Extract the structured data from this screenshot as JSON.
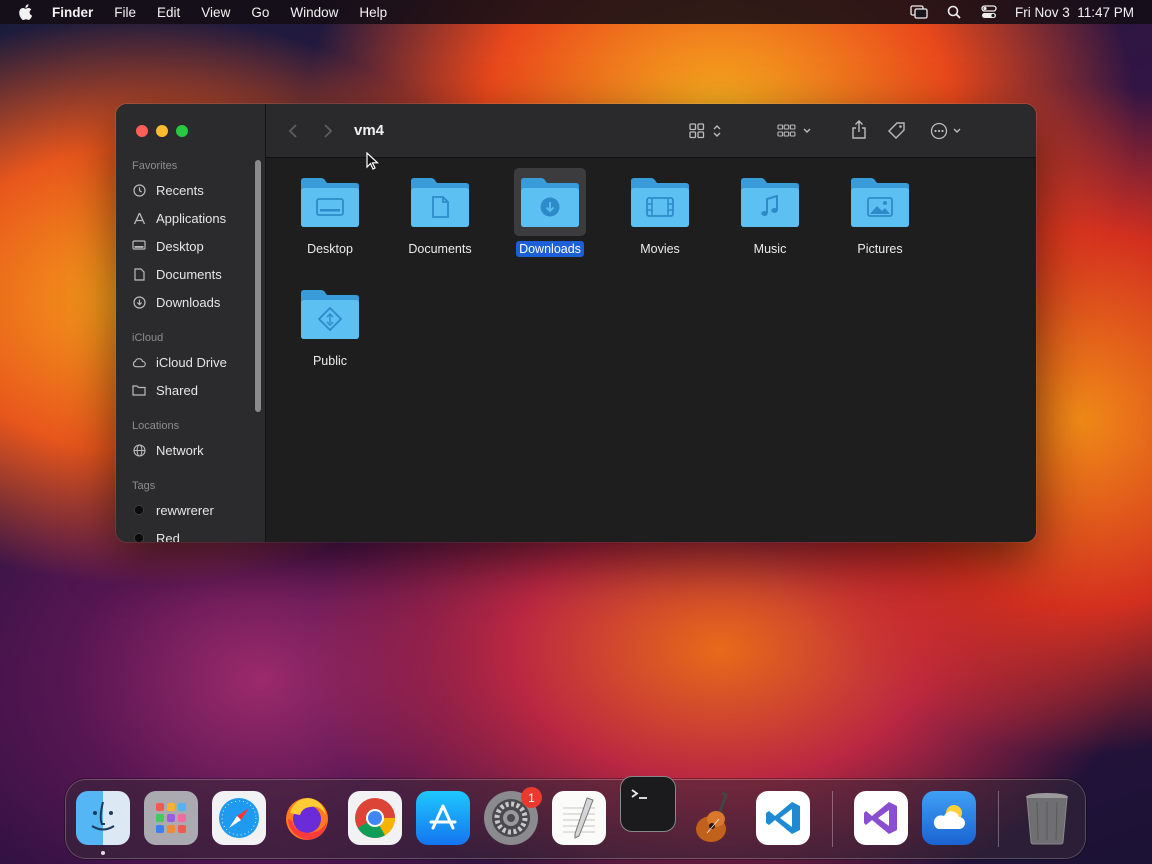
{
  "menubar": {
    "app_name": "Finder",
    "menus": [
      "File",
      "Edit",
      "View",
      "Go",
      "Window",
      "Help"
    ],
    "clock": "Fri Nov 3  11:47 PM",
    "status_icons": [
      "screen-mirroring-icon",
      "spotlight-icon",
      "control-center-icon"
    ]
  },
  "window": {
    "title": "vm4",
    "sidebar": {
      "favorites_header": "Favorites",
      "favorites": [
        {
          "label": "Recents",
          "icon": "clock-icon"
        },
        {
          "label": "Applications",
          "icon": "applications-icon"
        },
        {
          "label": "Desktop",
          "icon": "desktop-icon"
        },
        {
          "label": "Documents",
          "icon": "document-icon"
        },
        {
          "label": "Downloads",
          "icon": "download-icon"
        }
      ],
      "icloud_header": "iCloud",
      "icloud": [
        {
          "label": "iCloud Drive",
          "icon": "cloud-icon"
        },
        {
          "label": "Shared",
          "icon": "shared-folder-icon"
        }
      ],
      "locations_header": "Locations",
      "locations": [
        {
          "label": "Network",
          "icon": "globe-icon"
        }
      ],
      "tags_header": "Tags",
      "tags": [
        {
          "label": "rewwrerer",
          "color": "#111111"
        },
        {
          "label": "Red",
          "color": "#111111"
        }
      ]
    },
    "folders": [
      {
        "label": "Desktop",
        "glyph": "desktop",
        "selected": false
      },
      {
        "label": "Documents",
        "glyph": "document",
        "selected": false
      },
      {
        "label": "Downloads",
        "glyph": "download",
        "selected": true
      },
      {
        "label": "Movies",
        "glyph": "film",
        "selected": false
      },
      {
        "label": "Music",
        "glyph": "music",
        "selected": false
      },
      {
        "label": "Pictures",
        "glyph": "photo",
        "selected": false
      },
      {
        "label": "Public",
        "glyph": "public",
        "selected": false
      }
    ]
  },
  "dock": {
    "apps": [
      "Finder",
      "Launchpad",
      "Safari",
      "Firefox",
      "Google Chrome",
      "App Store",
      "System Settings",
      "TextEdit",
      "Terminal",
      "GarageBand",
      "Visual Studio Code",
      "Visual Studio",
      "Weather",
      "Trash"
    ],
    "settings_badge": "1"
  },
  "colors": {
    "accent": "#1c5fd6",
    "folder_blue": "#4fb3ea",
    "close": "#ff5f57",
    "minimize": "#febc2e",
    "zoom": "#28c840"
  }
}
